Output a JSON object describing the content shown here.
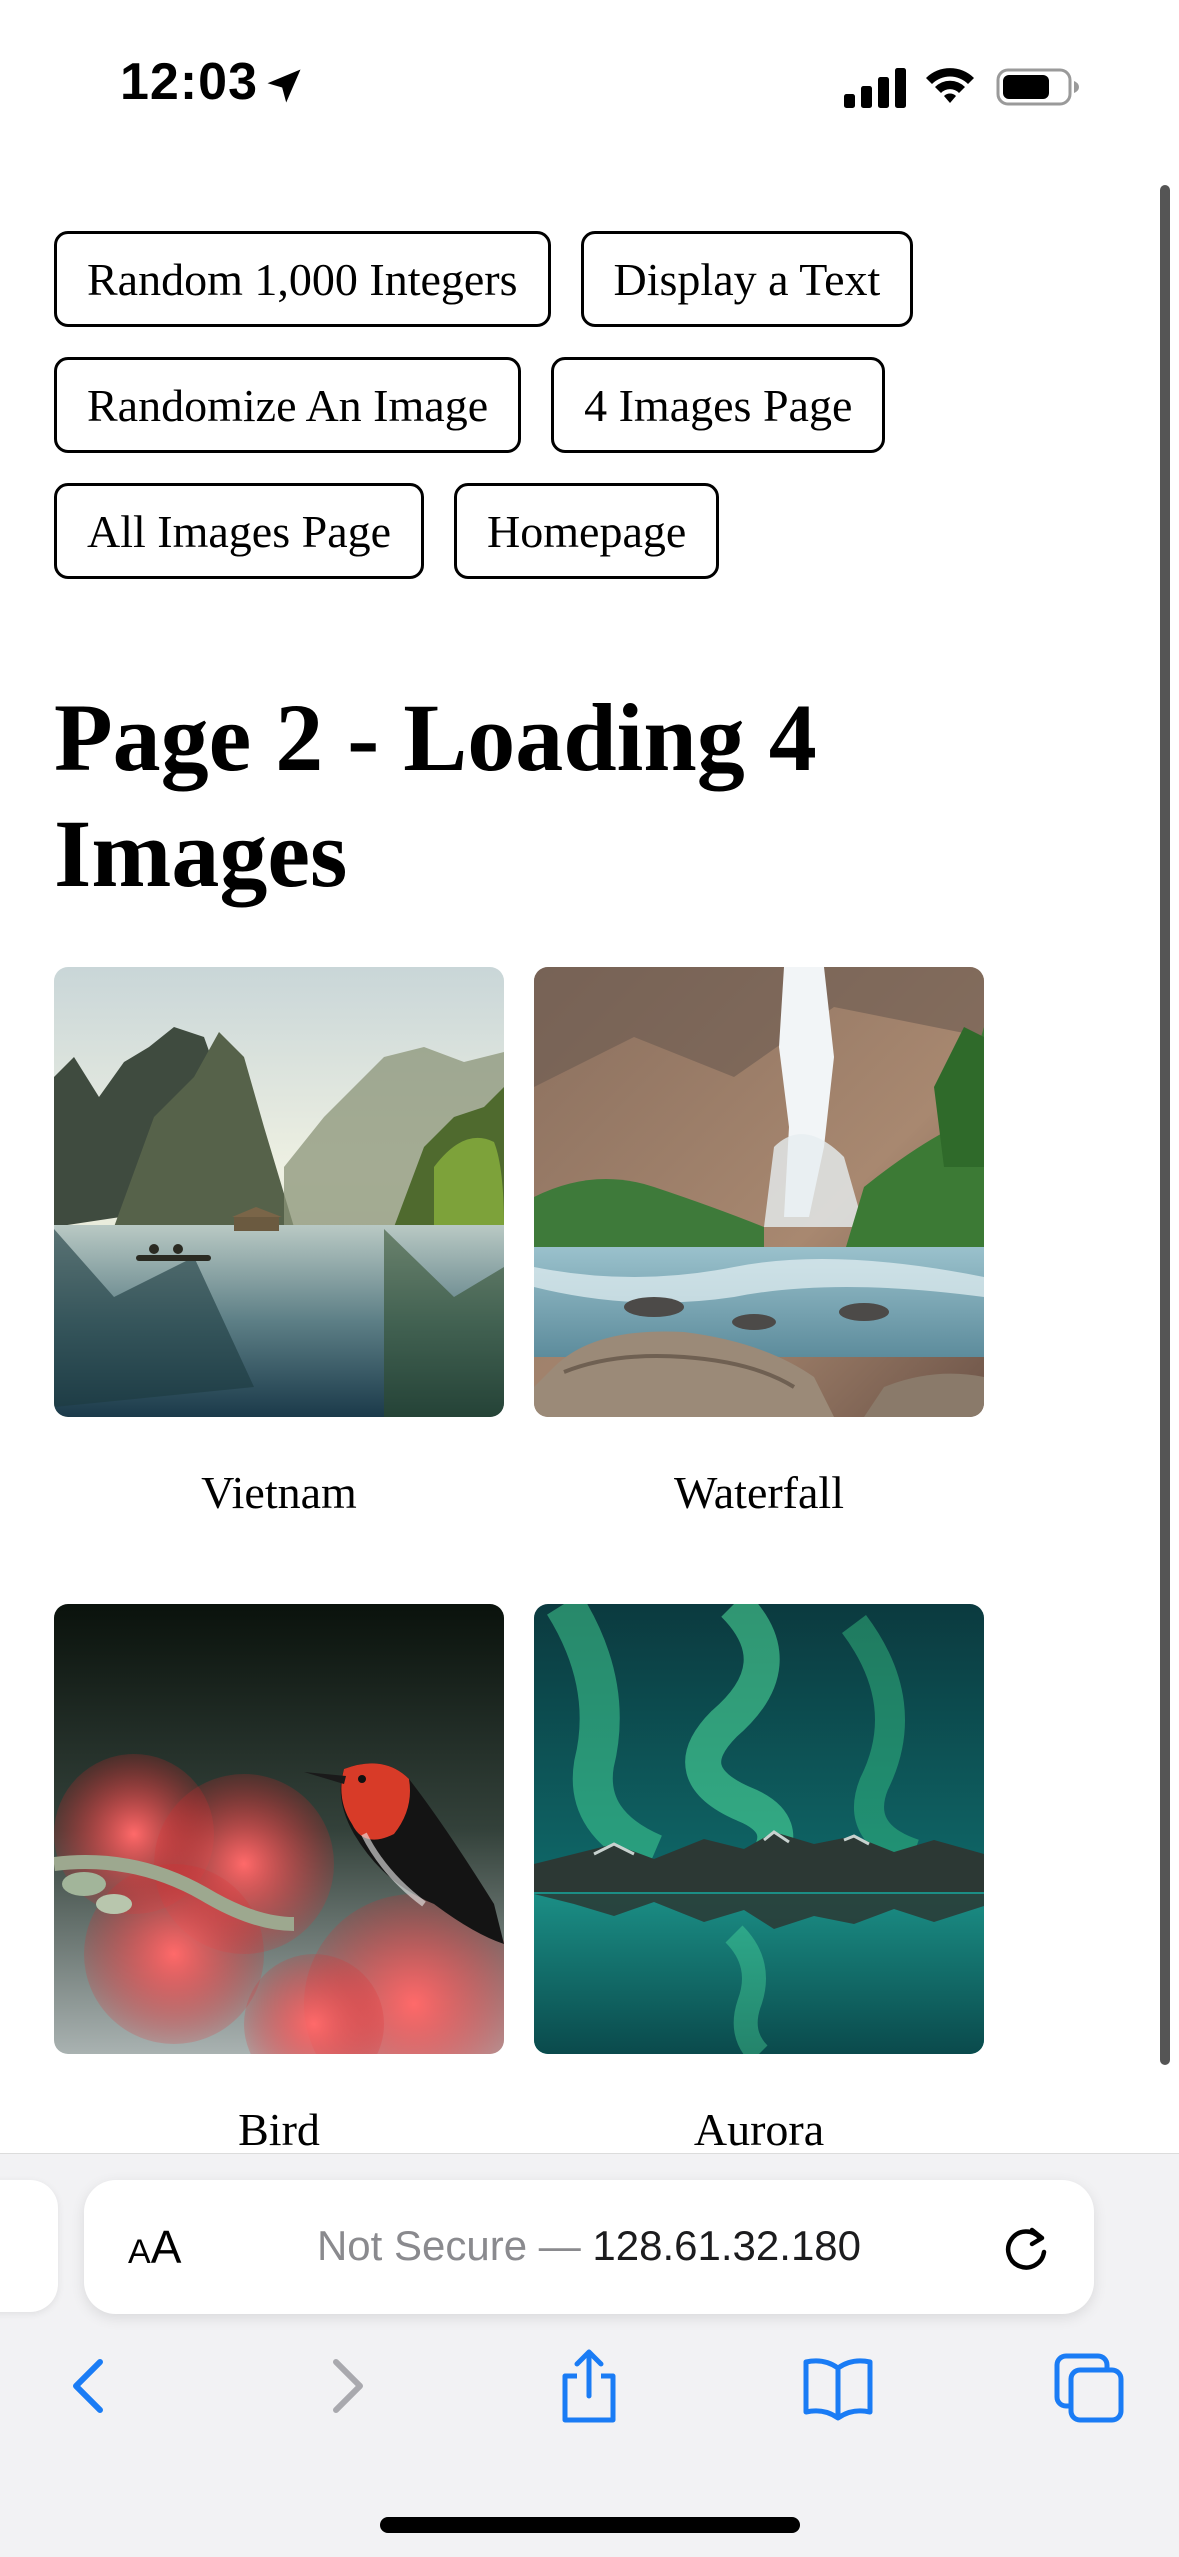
{
  "status_bar": {
    "time": "12:03",
    "icons": [
      "location-arrow-icon",
      "cellular-signal-icon",
      "wifi-icon",
      "battery-icon"
    ]
  },
  "nav": {
    "row1": [
      "Random 1,000 Integers",
      "Display a Text"
    ],
    "row2": [
      "Randomize An Image",
      "4 Images Page"
    ],
    "row3": [
      "All Images Page",
      "Homepage"
    ]
  },
  "page": {
    "title": "Page 2 - Loading 4 Images"
  },
  "gallery": [
    {
      "caption": "Vietnam",
      "subject": "limestone karst mountains reflected in calm river with boat"
    },
    {
      "caption": "Waterfall",
      "subject": "waterfall over rocky cliff with rushing river"
    },
    {
      "caption": "Bird",
      "subject": "red-headed bird perched among red bottlebrush flowers"
    },
    {
      "caption": "Aurora",
      "subject": "green aurora over mountains reflected in water"
    }
  ],
  "browser": {
    "text_size_button": "AA",
    "url_prefix": "Not Secure —",
    "url_host": "128.61.32.180",
    "accent_color": "#1a7cf5",
    "toolbar_icons": [
      "back-icon",
      "forward-icon",
      "share-icon",
      "bookmarks-icon",
      "tabs-icon"
    ]
  }
}
